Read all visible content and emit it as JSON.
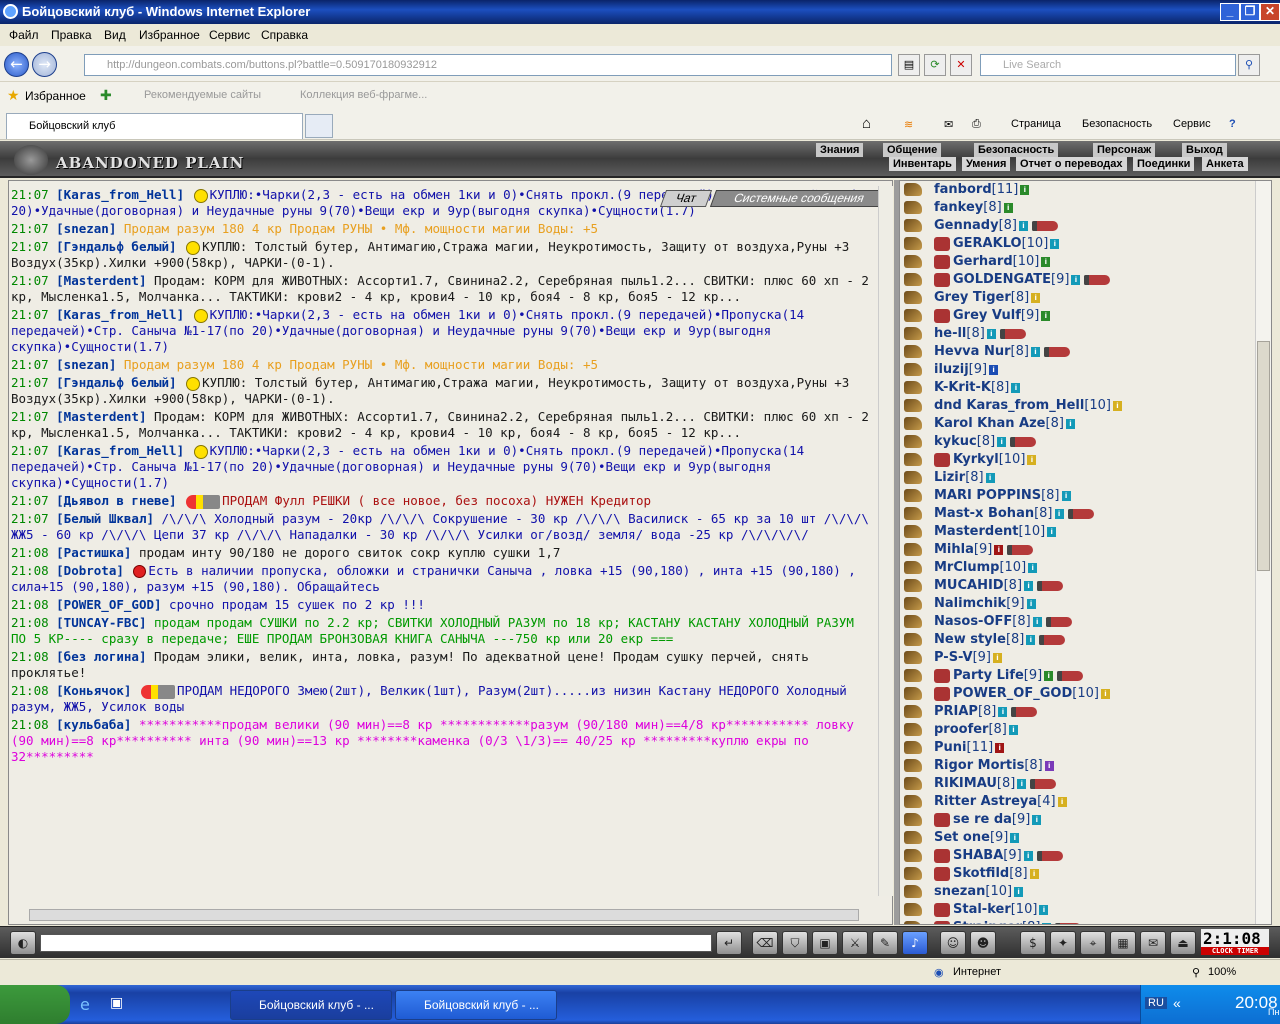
{
  "window": {
    "title": "Бойцовский клуб - Windows Internet Explorer"
  },
  "menu": [
    "Файл",
    "Правка",
    "Вид",
    "Избранное",
    "Сервис",
    "Справка"
  ],
  "address": {
    "url": "http://dungeon.combats.com/buttons.pl?battle=0.509170180932912",
    "search_placeholder": "Live Search"
  },
  "favorites": {
    "label": "Избранное",
    "recommended": "Рекомендуемые сайты",
    "gallery": "Коллекция веб-фрагме..."
  },
  "tab": {
    "title": "Бойцовский клуб"
  },
  "ie_tools": {
    "page": "Страница",
    "security": "Безопасность",
    "service": "Сервис"
  },
  "game": {
    "location": "ABANDONED PLAIN",
    "top_nav": [
      "Знания",
      "Общение",
      "Безопасность",
      "Персонаж",
      "Выход"
    ],
    "sub_nav": [
      "Инвентарь",
      "Умения",
      "Отчет о переводах",
      "Поединки",
      "Анкета"
    ],
    "chat_tabs": {
      "chat": "Чат",
      "system": "Системные сообщения"
    },
    "clock": "2:1:08",
    "clock_label": "CLOCK TIMER"
  },
  "chat": [
    {
      "time": "21:07",
      "nick": "Karas_from_Hell",
      "icons": "smile",
      "color": "blue",
      "text": "КУПЛЮ:•Чарки(2,3 - есть на обмен 1ки и 0)•Снять прокл.(9 передачей)•Стр. Саныча №1-17(по 20)•Удачные(договорная) и Неудачные руны 9(70)•Вещи екр и 9ур(выгодня скупка)•Сущности(1.7)"
    },
    {
      "time": "21:07",
      "nick": "snezan",
      "icons": "",
      "color": "orange",
      "text": "Продам разум 180 4 кр Продам РУНЫ • Мф. мощности магии Воды: +5"
    },
    {
      "time": "21:07",
      "nick": "Гэндальф белый",
      "icons": "smile2",
      "color": "black",
      "text": "КУПЛЮ: Толстый бутер, Антимагию,Стража магии, Неукротимость, Защиту от воздуха,Руны +3 Воздух(35кр).Хилки +900(58кр), ЧАРКИ-(0-1)."
    },
    {
      "time": "21:07",
      "nick": "Masterdent",
      "icons": "",
      "color": "black",
      "text": "Продам: КОРМ для ЖИВОТНЫХ: Ассорти1.7, Свинина2.2, Серебряная пыль1.2... СВИТКИ: плюс 60 хп - 2 кр, Мысленка1.5, Молчанка... ТАКТИКИ: крови2 - 4 кр, крови4 - 10 кр, боя4 - 8 кр, боя5 - 12 кр..."
    },
    {
      "time": "21:07",
      "nick": "Karas_from_Hell",
      "icons": "smile",
      "color": "blue",
      "text": "КУПЛЮ:•Чарки(2,3 - есть на обмен 1ки и 0)•Снять прокл.(9 передачей)•Пропуска(14 передачей)•Стр. Саныча №1-17(по 20)•Удачные(договорная) и Неудачные руны 9(70)•Вещи екр и 9ур(выгодня скупка)•Сущности(1.7)"
    },
    {
      "time": "21:07",
      "nick": "snezan",
      "icons": "",
      "color": "orange",
      "text": "Продам разум 180 4 кр Продам РУНЫ • Мф. мощности магии Воды: +5"
    },
    {
      "time": "21:07",
      "nick": "Гэндальф белый",
      "icons": "smile2",
      "color": "black",
      "text": "КУПЛЮ: Толстый бутер, Антимагию,Стража магии, Неукротимость, Защиту от воздуха,Руны +3 Воздух(35кр).Хилки +900(58кр), ЧАРКИ-(0-1)."
    },
    {
      "time": "21:07",
      "nick": "Masterdent",
      "icons": "",
      "color": "black",
      "text": "Продам: КОРМ для ЖИВОТНЫХ: Ассорти1.7, Свинина2.2, Серебряная пыль1.2... СВИТКИ: плюс 60 хп - 2 кр, Мысленка1.5, Молчанка... ТАКТИКИ: крови2 - 4 кр, крови4 - 10 кр, боя4 - 8 кр, боя5 - 12 кр..."
    },
    {
      "time": "21:07",
      "nick": "Karas_from_Hell",
      "icons": "smile",
      "color": "blue",
      "text": "КУПЛЮ:•Чарки(2,3 - есть на обмен 1ки и 0)•Снять прокл.(9 передачей)•Пропуска(14 передачей)•Стр. Саныча №1-17(по 20)•Удачные(договорная) и Неудачные руны 9(70)•Вещи екр и 9ур(выгодня скупка)•Сущности(1.7)"
    },
    {
      "time": "21:07",
      "nick": "Дьявол в гневе",
      "icons": "mega",
      "color": "red",
      "text": "ПРОДАМ Фулл РЕШКИ ( все новое, без посоха) НУЖЕН Кредитор"
    },
    {
      "time": "21:07",
      "nick": "Белый Шквал",
      "icons": "",
      "color": "blue",
      "text": "/\\/\\/\\ Холодный разум - 20кр /\\/\\/\\ Сокрушение - 30 кр /\\/\\/\\ Василиск - 65 кр за 10 шт /\\/\\/\\ ЖЖ5 - 60 кр /\\/\\/\\ Цепи 37 кр /\\/\\/\\ Нападалки - 30 кр /\\/\\/\\ Усилки ог/возд/ земля/ вода -25 кр /\\/\\/\\/\\/"
    },
    {
      "time": "21:08",
      "nick": "Растишка",
      "icons": "",
      "color": "black",
      "text": "продам инту 90/180 не дорого свиток сокр куплю сушки 1,7"
    },
    {
      "time": "21:08",
      "nick": "Dobrota",
      "icons": "balls",
      "color": "blue",
      "text": "Есть в наличии пропуска, обложки и странички Саныча , ловка +15 (90,180) , инта +15 (90,180) , сила+15 (90,180), разум +15 (90,180). Обращайтесь"
    },
    {
      "time": "21:08",
      "nick": "POWER_OF_GOD",
      "icons": "",
      "color": "blue",
      "text": "срочно продам 15 сушек по 2 кр !!!"
    },
    {
      "time": "21:08",
      "nick": "TUNCAY-FBC",
      "icons": "",
      "color": "green",
      "text": "продам продам СУШКИ по 2.2 кр; СВИТКИ ХОЛОДНЫЙ РАЗУМ по 18 кр; КАСТАНУ КАСТАНУ ХОЛОДНЫЙ РАЗУМ ПО 5 КР---- сразу в передаче; ЕШЕ ПРОДАМ БРОНЗОВАЯ КНИГА САНЫЧА ---750 кр или 20 екр ==="
    },
    {
      "time": "21:08",
      "nick": "без логина",
      "icons": "",
      "color": "black",
      "text": "Продам элики, велик, инта, ловка, разум! По адекватной цене! Продам сушку перчей, снять проклятье!"
    },
    {
      "time": "21:08",
      "nick": "Коньячок",
      "icons": "mega",
      "color": "blue",
      "text": "ПРОДАМ НЕДОРОГО Змею(2шт), Велкик(1шт), Разум(2шт).....из низин Кастану НЕДОРОГО Холодный разум, ЖЖ5, Усилок воды"
    },
    {
      "time": "21:08",
      "nick": "кульбаба",
      "icons": "",
      "color": "magenta",
      "text": "***********продам велики (90 мин)==8 кр ************разум (90/180 мин)==4/8 кр*********** ловку (90 мин)==8 кр********** инта (90 мин)==13 кр ********каменка (0/3 \\1/3)== 40/25 кр *********куплю екры по 32*********"
    }
  ],
  "users": [
    {
      "name": "fanbord",
      "level": "[11]",
      "badge": "g"
    },
    {
      "name": "fankey",
      "level": "[8]",
      "badge": "g"
    },
    {
      "name": "Gennady",
      "level": "[8]",
      "badge": "c",
      "lock": true
    },
    {
      "name": "GERAKLO",
      "level": "[10]",
      "badge": "c",
      "klan": true
    },
    {
      "name": "Gerhard",
      "level": "[10]",
      "badge": "g",
      "klan": true
    },
    {
      "name": "GOLDENGATE",
      "level": "[9]",
      "badge": "c",
      "lock": true,
      "klan": true
    },
    {
      "name": "Grey Tiger",
      "level": "[8]",
      "badge": "y"
    },
    {
      "name": "Grey Vulf",
      "level": "[9]",
      "badge": "g",
      "klan": true
    },
    {
      "name": "he-ll",
      "level": "[8]",
      "badge": "c",
      "lock": true
    },
    {
      "name": "Hevva Nur",
      "level": "[8]",
      "badge": "c",
      "lock": true
    },
    {
      "name": "iluzij",
      "level": "[9]",
      "badge": "b"
    },
    {
      "name": "K-Krit-K",
      "level": "[8]",
      "badge": "c"
    },
    {
      "name": "dnd Karas_from_Hell",
      "level": "[10]",
      "badge": "y"
    },
    {
      "name": "Karol Khan Aze",
      "level": "[8]",
      "badge": "c"
    },
    {
      "name": "kykuc",
      "level": "[8]",
      "badge": "c",
      "lock": true
    },
    {
      "name": "Kyrkyl",
      "level": "[10]",
      "badge": "y",
      "klan": true
    },
    {
      "name": "Lizir",
      "level": "[8]",
      "badge": "c"
    },
    {
      "name": "MARI POPPINS",
      "level": "[8]",
      "badge": "c"
    },
    {
      "name": "Mast-x Bohan",
      "level": "[8]",
      "badge": "c",
      "lock": true
    },
    {
      "name": "Masterdent",
      "level": "[10]",
      "badge": "c"
    },
    {
      "name": "Mihla",
      "level": "[9]",
      "badge": "r",
      "lock": true
    },
    {
      "name": "MrClump",
      "level": "[10]",
      "badge": "c"
    },
    {
      "name": "MUCAHID",
      "level": "[8]",
      "badge": "c",
      "lock": true
    },
    {
      "name": "Nalimchik",
      "level": "[9]",
      "badge": "c"
    },
    {
      "name": "Nasos-OFF",
      "level": "[8]",
      "badge": "c",
      "lock": true
    },
    {
      "name": "New style",
      "level": "[8]",
      "badge": "c",
      "lock": true
    },
    {
      "name": "P-S-V",
      "level": "[9]",
      "badge": "y"
    },
    {
      "name": "Party Life",
      "level": "[9]",
      "badge": "g",
      "lock": true,
      "klan": true
    },
    {
      "name": "POWER_OF_GOD",
      "level": "[10]",
      "badge": "y",
      "klan": true
    },
    {
      "name": "PRIAP",
      "level": "[8]",
      "badge": "c",
      "lock": true
    },
    {
      "name": "proofer",
      "level": "[8]",
      "badge": "c"
    },
    {
      "name": "Puni",
      "level": "[11]",
      "badge": "r"
    },
    {
      "name": "Rigor Mortis",
      "level": "[8]",
      "badge": "p"
    },
    {
      "name": "RIKIMAU",
      "level": "[8]",
      "badge": "c",
      "lock": true
    },
    {
      "name": "Ritter Astreya",
      "level": "[4]",
      "badge": "y"
    },
    {
      "name": "se re da",
      "level": "[9]",
      "badge": "c",
      "klan": true
    },
    {
      "name": "Set one",
      "level": "[9]",
      "badge": "c"
    },
    {
      "name": "SHABA",
      "level": "[9]",
      "badge": "c",
      "lock": true,
      "klan": true
    },
    {
      "name": "Skotfild",
      "level": "[8]",
      "badge": "y",
      "klan": true
    },
    {
      "name": "snezan",
      "level": "[10]",
      "badge": "c"
    },
    {
      "name": "Stal-ker",
      "level": "[10]",
      "badge": "c",
      "klan": true
    },
    {
      "name": "Strainger",
      "level": "[8]",
      "badge": "c",
      "lock": true,
      "klan": true
    }
  ],
  "status": {
    "zone": "Интернет",
    "zoom": "100%"
  },
  "taskbar": {
    "task1": "Бойцовский клуб - ...",
    "task2": "Бойцовский клуб - ...",
    "lang": "RU",
    "time": "20:08",
    "day": "Пн"
  }
}
